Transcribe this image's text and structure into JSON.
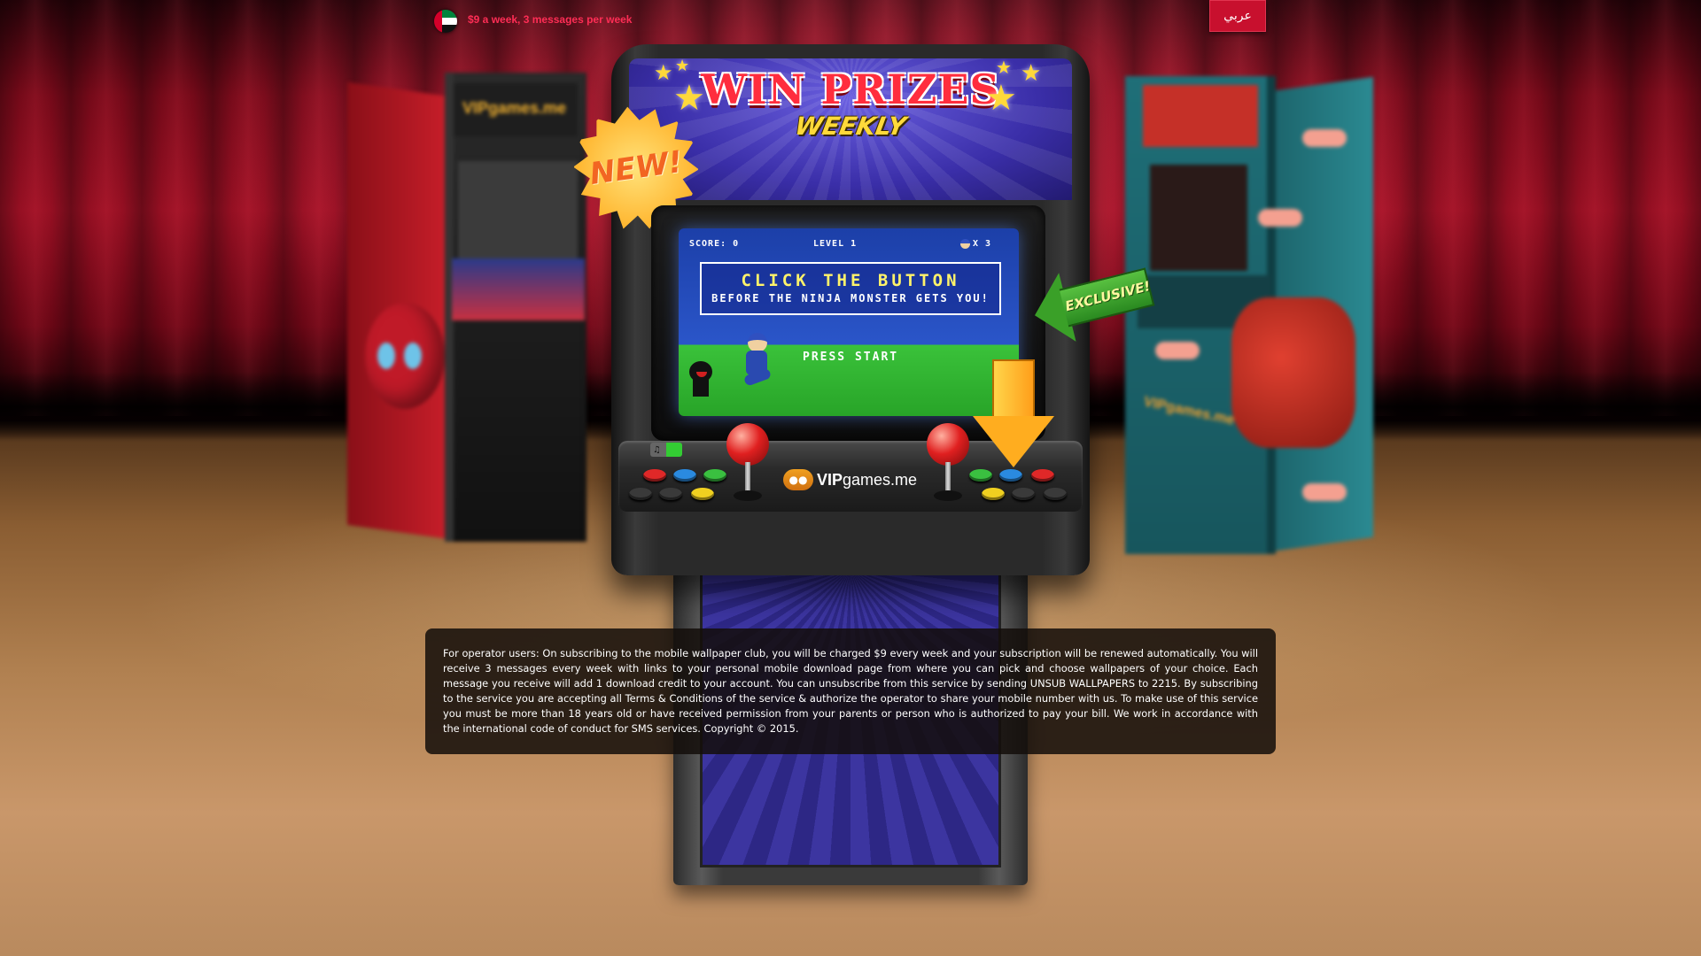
{
  "topbar": {
    "price_text": "$9 a week, 3 messages per week",
    "language_button": "عربي",
    "flag_icon": "uae-flag-icon"
  },
  "marquee": {
    "title": "WIN PRIZES",
    "subtitle": "WEEKLY"
  },
  "badges": {
    "new": "NEW!",
    "exclusive": "EXCLUSIVE!"
  },
  "game_screen": {
    "score_label": "SCORE: 0",
    "level_label": "LEVEL 1",
    "lives_label": "X 3",
    "headline": "CLICK THE BUTTON",
    "subline": "BEFORE THE NINJA MONSTER GETS YOU!",
    "press_start": "PRESS START"
  },
  "control_panel": {
    "sound_icon": "music-note-icon",
    "sound_on": true,
    "logo_text_bold": "VIP",
    "logo_text": "games.me",
    "left_buttons": [
      "red",
      "blue",
      "green",
      "dark",
      "dark",
      "yellow"
    ],
    "right_buttons": [
      "green",
      "blue",
      "red",
      "yellow",
      "dark",
      "dark"
    ]
  },
  "side_cabinets": {
    "left_marquee": "VIPgames.me",
    "right_logo": "VIPgames.me"
  },
  "terms": {
    "text": "For operator users: On subscribing to the mobile wallpaper club, you will be charged $9 every week and your subscription will be renewed automatically. You will receive 3 messages every week with links to your personal mobile download page from where you can pick and choose wallpapers of your choice. Each message you receive will add 1 download credit to your account. You can unsubscribe from this service by sending UNSUB WALLPAPERS to 2215. By subscribing to the service you are accepting all Terms & Conditions of the service & authorize the operator to share your mobile number with us. To make use of this service you must be more than 18 years old or have received permission from your parents or person who is authorized to pay your bill. We work in accordance with the international code of conduct for SMS services. Copyright © 2015."
  },
  "colors": {
    "accent": "#ff2d55",
    "lang_button": "#c8102e",
    "title_red": "#ff2d3d",
    "title_yellow": "#ffd93a"
  }
}
